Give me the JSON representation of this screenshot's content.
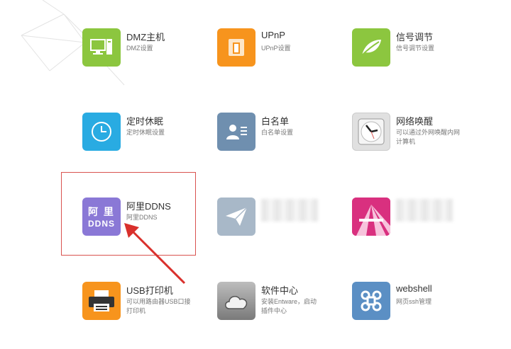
{
  "tiles": [
    {
      "label": "DMZ主机",
      "desc": "DMZ设置",
      "icon": "computer-icon",
      "color": "#8cc63f"
    },
    {
      "label": "UPnP",
      "desc": "UPnP设置",
      "icon": "upnp-icon",
      "color": "#f7941d"
    },
    {
      "label": "信号调节",
      "desc": "信号调节设置",
      "icon": "leaf-icon",
      "color": "#8cc63f"
    },
    {
      "label": "定时休眠",
      "desc": "定时休眠设置",
      "icon": "clock-icon",
      "color": "#29abe2"
    },
    {
      "label": "白名单",
      "desc": "白名单设置",
      "icon": "contact-card-icon",
      "color": "#6f8faf"
    },
    {
      "label": "网络唤醒",
      "desc": "可以通过外网唤醒内网计算机",
      "icon": "wall-clock-icon",
      "color": "#e0e0e0"
    },
    {
      "label": "阿里DDNS",
      "desc": "阿里DDNS",
      "icon": "aliddns-icon",
      "color": "#8a78d6",
      "icon_text_1": "阿 里",
      "icon_text_2": "DDNS"
    },
    {
      "label": "",
      "desc": "",
      "icon": "paper-plane-icon",
      "color": "#a8b8c8"
    },
    {
      "label": "",
      "desc": "",
      "icon": "pink-fan-icon",
      "color": "#d9307f"
    },
    {
      "label": "USB打印机",
      "desc": "可以用路由器USB口接打印机",
      "icon": "printer-icon",
      "color": "#f7941d"
    },
    {
      "label": "软件中心",
      "desc": "安装Entware，启动插件中心",
      "icon": "cloud-icon",
      "color": "#8a8a8a"
    },
    {
      "label": "webshell",
      "desc": "网页ssh管理",
      "icon": "command-key-icon",
      "color": "#5b8fc4"
    }
  ]
}
